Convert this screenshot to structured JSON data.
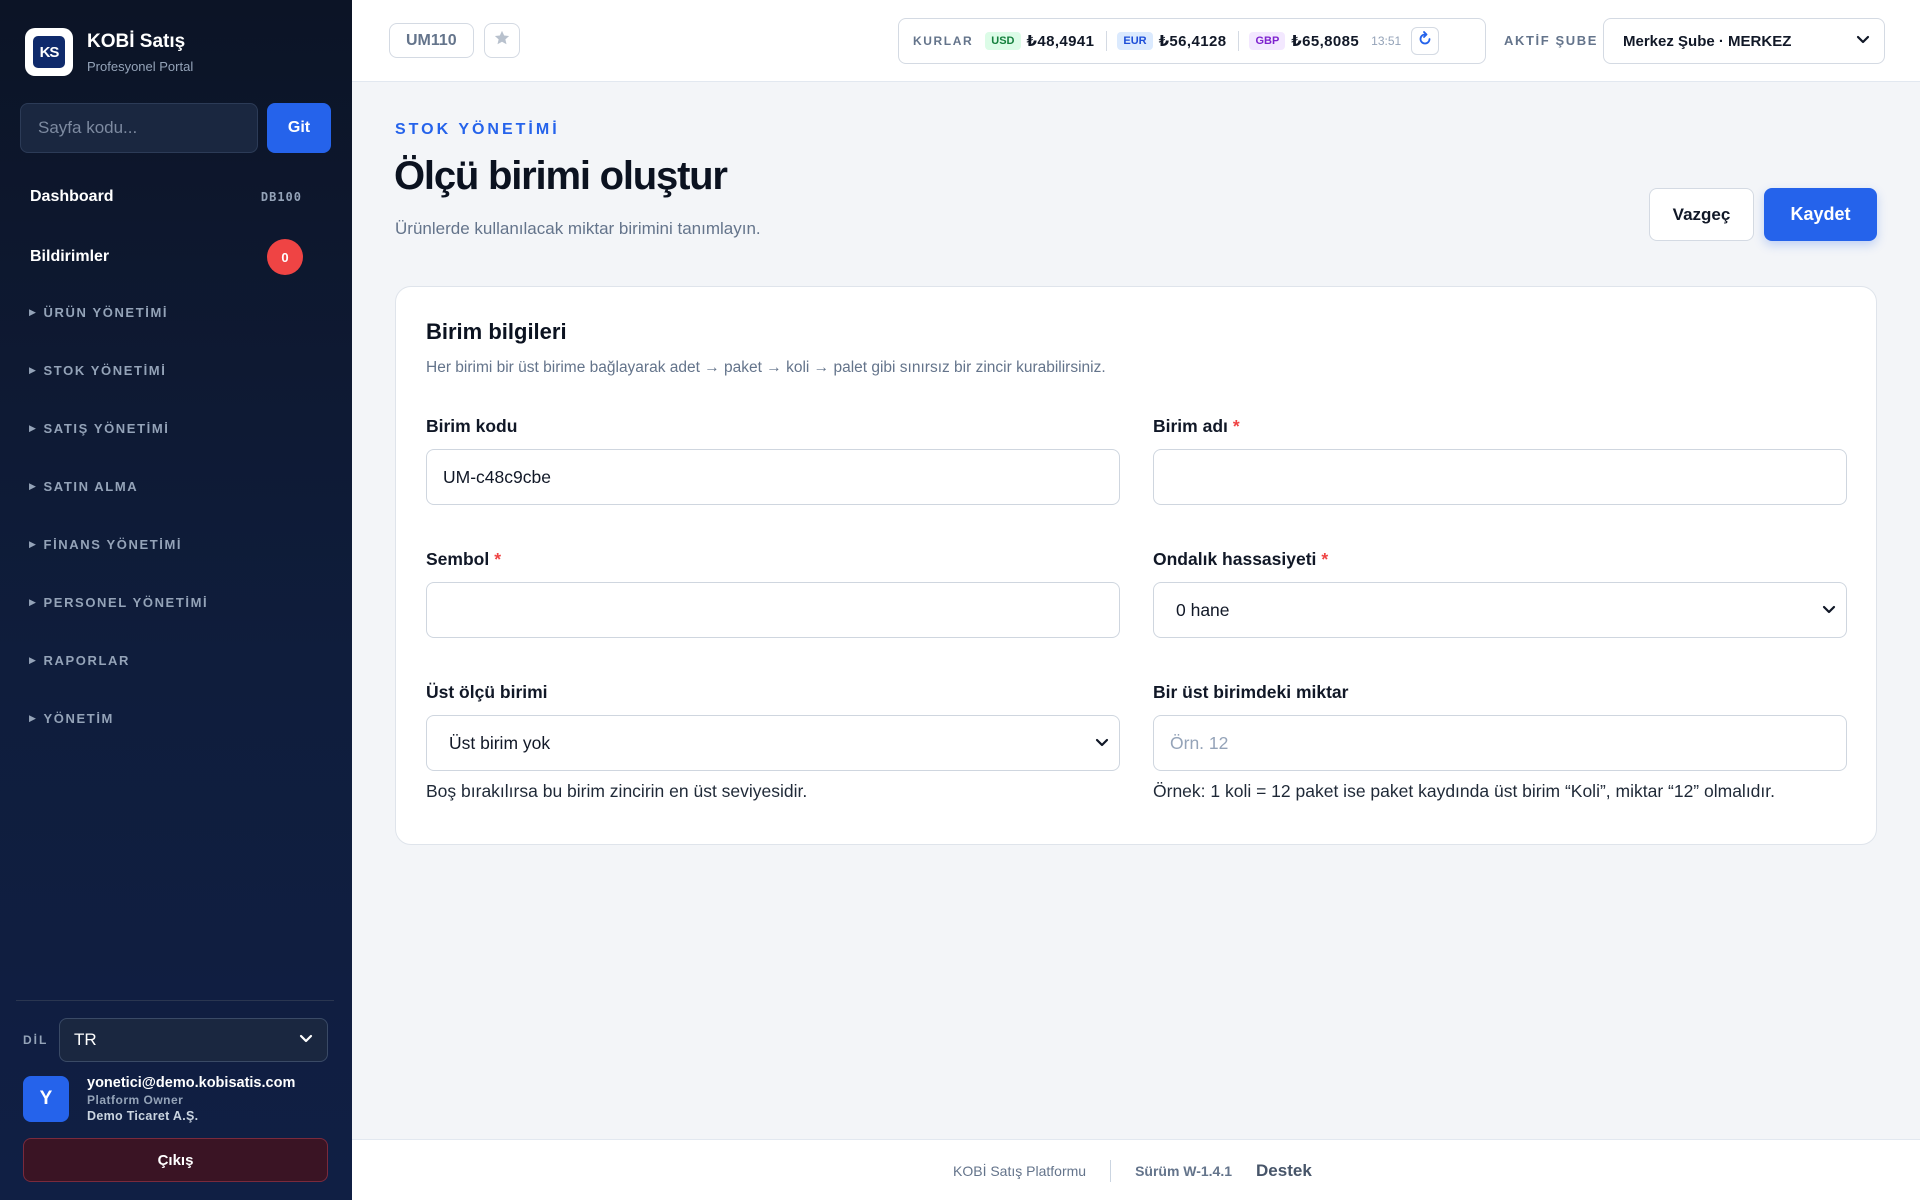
{
  "brand": {
    "title": "KOBİ Satış",
    "subtitle": "Profesyonel Portal",
    "logo_text": "KS"
  },
  "sidebar": {
    "page_code_placeholder": "Sayfa kodu...",
    "go_label": "Git",
    "dashboard": {
      "label": "Dashboard",
      "code": "DB100"
    },
    "notifications": {
      "label": "Bildirimler",
      "count": "0"
    },
    "sections": [
      "ÜRÜN YÖNETİMİ",
      "STOK YÖNETİMİ",
      "SATIŞ YÖNETİMİ",
      "SATIN ALMA",
      "FİNANS YÖNETİMİ",
      "PERSONEL YÖNETİMİ",
      "RAPORLAR",
      "YÖNETİM"
    ],
    "lang_label": "DİL",
    "lang_value": "TR",
    "user": {
      "initial": "Y",
      "email": "yonetici@demo.kobisatis.com",
      "role": "Platform Owner",
      "company": "Demo Ticaret A.Ş."
    },
    "logout_label": "Çıkış"
  },
  "topbar": {
    "page_code": "UM110",
    "rates_title": "KURLAR",
    "rates": [
      {
        "code": "USD",
        "value": "₺48,4941",
        "bg": "#dcfce7",
        "fg": "#15803d"
      },
      {
        "code": "EUR",
        "value": "₺56,4128",
        "bg": "#dbeafe",
        "fg": "#1d4ed8"
      },
      {
        "code": "GBP",
        "value": "₺65,8085",
        "bg": "#f3e8ff",
        "fg": "#7e22ce"
      }
    ],
    "rates_time": "13:51",
    "branch_label": "AKTİF ŞUBE",
    "branch_value": "Merkez Şube · MERKEZ"
  },
  "main": {
    "eyebrow": "STOK YÖNETİMİ",
    "title": "Ölçü birimi oluştur",
    "subtitle": "Ürünlerde kullanılacak miktar birimini tanımlayın.",
    "cancel_label": "Vazgeç",
    "save_label": "Kaydet",
    "card": {
      "title": "Birim bilgileri",
      "description": "Her birimi bir üst birime bağlayarak adet → paket → koli → palet gibi sınırsız bir zincir kurabilirsiniz.",
      "fields": {
        "unit_code": {
          "label": "Birim kodu",
          "value": "UM-c48c9cbe"
        },
        "unit_name": {
          "label": "Birim adı",
          "value": ""
        },
        "symbol": {
          "label": "Sembol",
          "value": ""
        },
        "precision": {
          "label": "Ondalık hassasiyeti",
          "value": "0 hane"
        },
        "parent_unit": {
          "label": "Üst ölçü birimi",
          "value": "Üst birim yok",
          "help": "Boş bırakılırsa bu birim zincirin en üst seviyesidir."
        },
        "parent_qty": {
          "label": "Bir üst birimdeki miktar",
          "placeholder": "Örn. 12",
          "help": "Örnek: 1 koli = 12 paket ise paket kaydında üst birim “Koli”, miktar “12” olmalıdır."
        }
      }
    }
  },
  "footer": {
    "name": "KOBİ Satış Platformu",
    "version": "Sürüm W-1.4.1",
    "support": "Destek"
  },
  "required_mark": "*",
  "icons": [
    "star-icon",
    "refresh-icon",
    "chevron-down-icon",
    "caret-right-icon"
  ],
  "colors": {
    "primary": "#2563eb",
    "danger": "#ef4444",
    "sidebar": "#0c1426"
  }
}
